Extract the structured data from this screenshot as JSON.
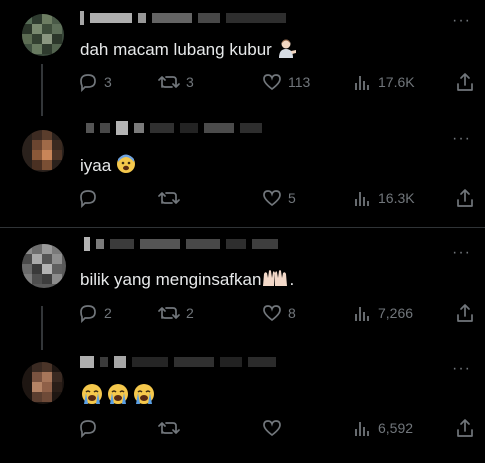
{
  "tweets": [
    {
      "text": "dah macam lubang kubur",
      "reply_count": "3",
      "retweet_count": "3",
      "like_count": "113",
      "view_count": "17.6K",
      "emoji": "person-tipping-hand"
    },
    {
      "text": "iyaa",
      "reply_count": "",
      "retweet_count": "",
      "like_count": "5",
      "view_count": "16.3K",
      "emoji": "anxious-face"
    },
    {
      "text": "bilik yang menginsafkan",
      "text_suffix": ".",
      "reply_count": "2",
      "retweet_count": "2",
      "like_count": "8",
      "view_count": "7,266",
      "emoji": "raised-hands"
    },
    {
      "text": "",
      "reply_count": "",
      "retweet_count": "",
      "like_count": "",
      "view_count": "6,592",
      "emoji": "crying-face x3"
    }
  ],
  "more_label": "···",
  "colors": {
    "background": "#000000",
    "text": "#e7e9ea",
    "muted": "#71767b",
    "divider": "#2f3336"
  }
}
